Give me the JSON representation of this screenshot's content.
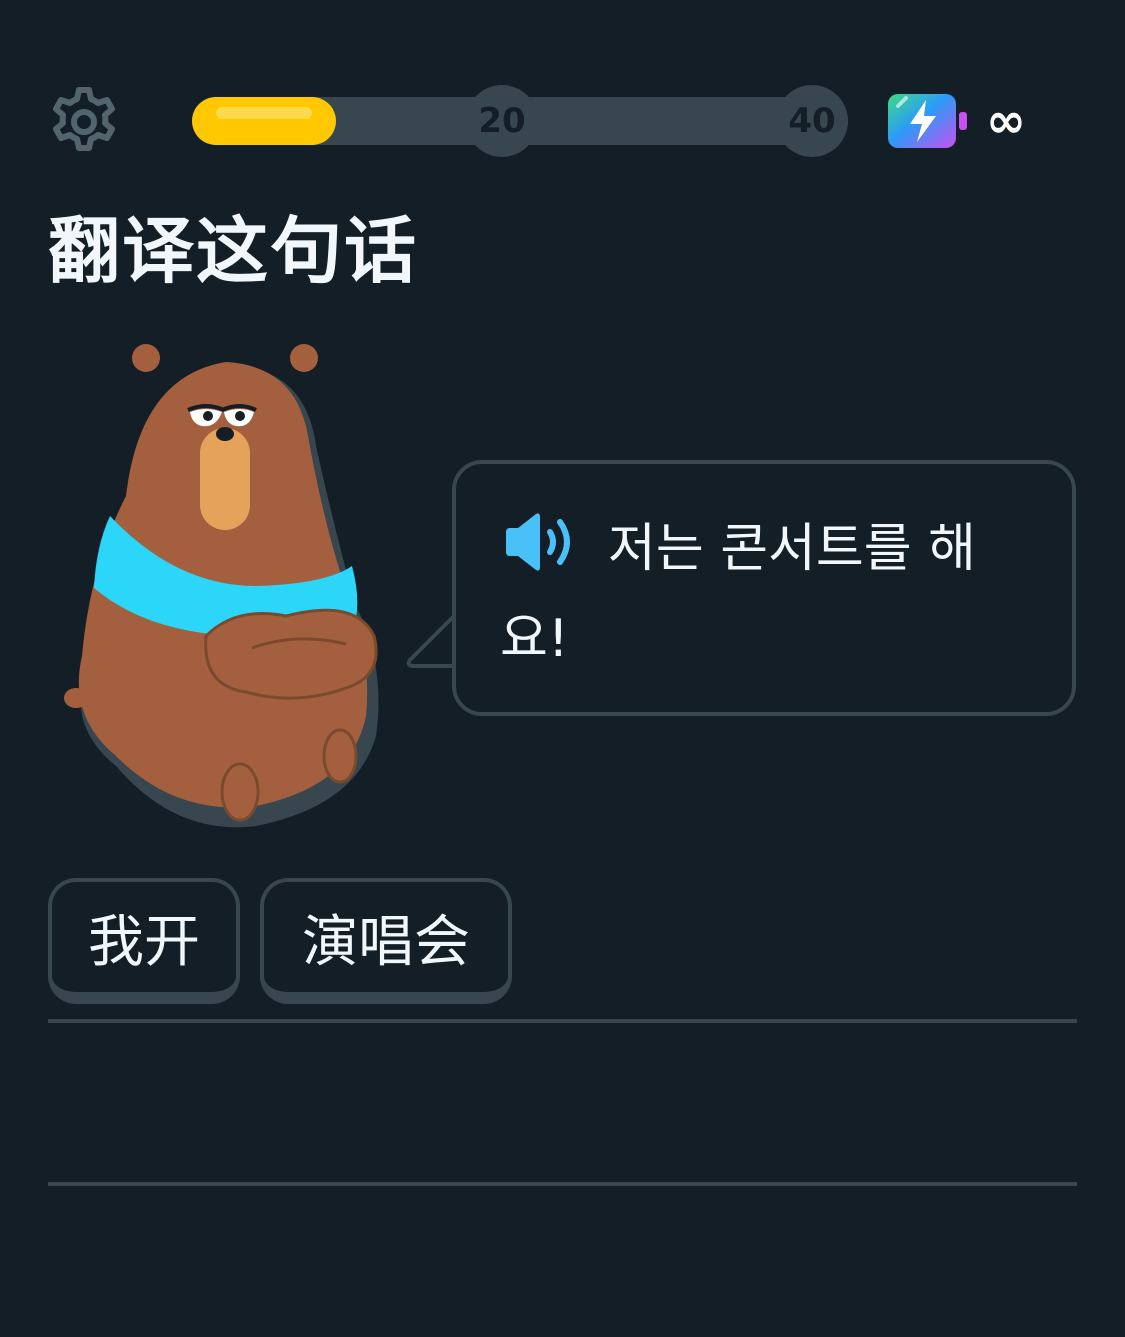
{
  "header": {
    "progress": {
      "percent": 0.22
    },
    "milestones": [
      "20",
      "40"
    ],
    "energy": {
      "icon": "lightning-battery-icon",
      "count": "∞"
    }
  },
  "prompt": {
    "title": "翻译这句话"
  },
  "bubble": {
    "speaker_icon": "speaker-icon",
    "text": "저는 콘서트를 해요!"
  },
  "answer_area": {
    "selected_words": [
      "我开",
      "演唱会"
    ]
  },
  "colors": {
    "background": "#141E26",
    "border": "#37464F",
    "progress_fill": "#FFC800",
    "speaker": "#49C0F8",
    "bear_fur": "#A4603E",
    "bear_scarf": "#2BD6F8"
  }
}
